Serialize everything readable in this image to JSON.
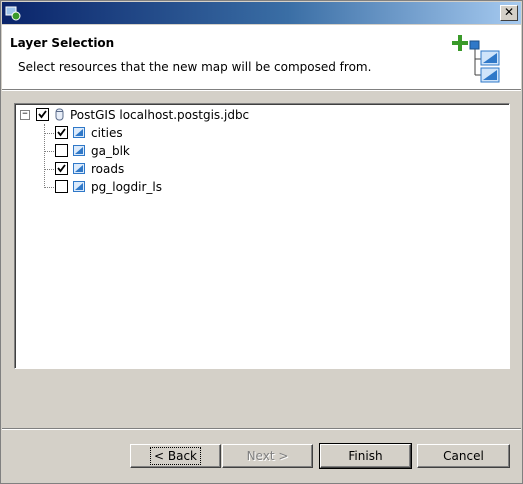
{
  "window": {
    "title": ""
  },
  "header": {
    "title": "Layer Selection",
    "description": "Select resources that the new map will be composed from."
  },
  "tree": {
    "root": {
      "label": "PostGIS localhost.postgis.jdbc",
      "checked": true,
      "expanded": true,
      "icon": "database-icon"
    },
    "children": [
      {
        "label": "cities",
        "checked": true,
        "icon": "layer-icon"
      },
      {
        "label": "ga_blk",
        "checked": false,
        "icon": "layer-icon"
      },
      {
        "label": "roads",
        "checked": true,
        "icon": "layer-icon"
      },
      {
        "label": "pg_logdir_ls",
        "checked": false,
        "icon": "layer-icon"
      }
    ]
  },
  "buttons": {
    "back": "< Back",
    "next": "Next >",
    "finish": "Finish",
    "cancel": "Cancel"
  },
  "colors": {
    "titlebar_start": "#0a246a",
    "titlebar_end": "#a6caf0",
    "dialog_bg": "#d4d0c8",
    "accent_green": "#3a9a2a",
    "accent_blue": "#2f78c8"
  }
}
